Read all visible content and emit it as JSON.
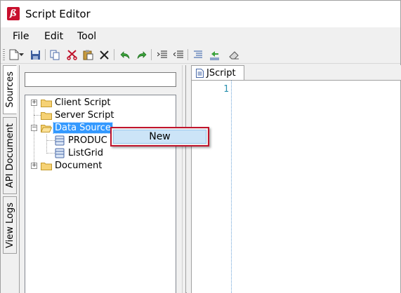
{
  "window": {
    "title": "Script Editor"
  },
  "menu": [
    "File",
    "Edit",
    "Tool"
  ],
  "toolbar": {
    "buttons": [
      "new-icon",
      "dropdown-arrow-icon",
      "save-icon",
      "copy-icon",
      "cut-icon",
      "paste-icon",
      "delete-icon",
      "undo-icon",
      "redo-icon",
      "indent-icon",
      "outdent-icon",
      "list-icon",
      "import-icon",
      "eraser-icon"
    ]
  },
  "side_tabs": [
    "Sources",
    "API Document",
    "View Logs"
  ],
  "search": {
    "value": "",
    "placeholder": ""
  },
  "tree": [
    {
      "label": "Client Script",
      "type": "folder",
      "expandable": true
    },
    {
      "label": "Server Script",
      "type": "folder",
      "expandable": false
    },
    {
      "label": "Data Source",
      "type": "folder",
      "expandable": true,
      "expanded": true,
      "selected": true
    },
    {
      "label": "PRODUC",
      "type": "datasource"
    },
    {
      "label": "ListGrid",
      "type": "datasource"
    },
    {
      "label": "Document",
      "type": "folder",
      "expandable": true
    }
  ],
  "editor": {
    "tab_label": "JScript",
    "line_numbers": [
      "1"
    ]
  },
  "context_menu": {
    "items": [
      "New"
    ]
  },
  "colors": {
    "selection": "#3399ff",
    "context_border": "#c0142c",
    "context_highlight": "#cce4f7",
    "line_number": "#2b91af"
  }
}
